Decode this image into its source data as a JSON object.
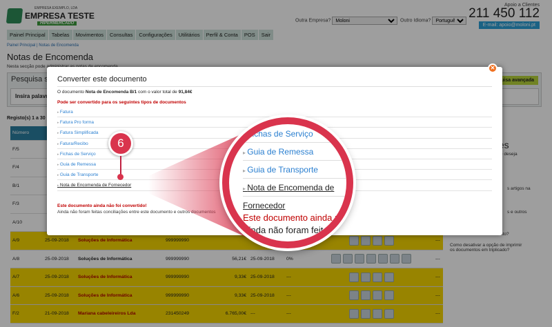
{
  "header": {
    "company_small": "EMPRESA EXEMPLO, LDA",
    "company": "EMPRESA TESTE",
    "tagline": "HIPERMERCADO",
    "other_company_label": "Outra Empresa?",
    "other_company_value": "Moloni",
    "language_label": "Outro Idioma?",
    "language_value": "Português",
    "support_label": "Apoio a Clientes",
    "phone": "211 450 112",
    "email": "E-mail: apoio@moloni.pt"
  },
  "nav": [
    "Painel Principal",
    "Tabelas",
    "Movimentos",
    "Consultas",
    "Configurações",
    "Utilitários",
    "Perfil & Conta",
    "POS",
    "Sair"
  ],
  "breadcrumb": [
    "Painel Principal",
    "Notas de Encomenda"
  ],
  "page": {
    "title": "Notas de Encomenda",
    "subtitle": "Nesta secção pode administrar as notas de encomenda",
    "search_title": "Pesquisa simples",
    "advanced": "Pesquisa avançada",
    "search_placeholder": "Insira palavras",
    "records": "Registo(s) 1 a 30"
  },
  "table": {
    "header": "Número",
    "rows": [
      {
        "num": "F/5",
        "y": false
      },
      {
        "num": "F/4",
        "y": false
      },
      {
        "num": "B/1",
        "y": false
      },
      {
        "num": "F/3",
        "y": false
      },
      {
        "num": "A/10",
        "y": false
      },
      {
        "num": "A/9",
        "date": "25-09-2018",
        "client": "Soluções de Informática",
        "nif": "999999990",
        "value": "",
        "due": "",
        "pct": "",
        "last": "---",
        "y": true
      },
      {
        "num": "A/8",
        "date": "25-09-2018",
        "client": "Soluções de Informática",
        "nif": "999999990",
        "value": "56,21€",
        "due": "25-09-2018",
        "pct": "0%",
        "last": "---",
        "y": false
      },
      {
        "num": "A/7",
        "date": "25-09-2018",
        "client": "Soluções de Informática",
        "nif": "999999990",
        "value": "9,33€",
        "due": "25-09-2018",
        "pct": "---",
        "last": "---",
        "y": true
      },
      {
        "num": "A/6",
        "date": "25-09-2018",
        "client": "Soluções de Informática",
        "nif": "999999990",
        "value": "9,33€",
        "due": "25-09-2018",
        "pct": "---",
        "last": "---",
        "y": true
      },
      {
        "num": "F/2",
        "date": "21-09-2018",
        "client": "Mariana cabeleireiros Lda",
        "nif": "231450249",
        "value": "6.765,00€",
        "due": "---",
        "pct": "---",
        "last": "---",
        "y": true
      }
    ]
  },
  "side": {
    "title": "ções",
    "t1": "e deseja",
    "t2": "s artigos na",
    "t3": "s e outros",
    "q1": "Como anular um documento?",
    "q2": "Como desativar a opção de imprimir os documentos em triplicado?"
  },
  "modal": {
    "title": "Converter este documento",
    "intro_pre": "O documento ",
    "doc": "Nota de Encomenda B/1",
    "intro_mid": " com o valor total de ",
    "total": "91,84€",
    "convert_label": "Pode ser convertido para os seguintes tipos de documentos",
    "options": [
      "Fatura",
      "Fatura Pro forma",
      "Fatura Simplificada",
      "Fatura/Recibo",
      "Fichas de Serviço",
      "Guia de Remessa",
      "Guia de Transporte",
      "Nota de Encomenda de Fornecedor"
    ],
    "warn_title": "Este documento ainda não foi convertido!",
    "warn_text": "Ainda não foram feitas conciliações entre este documento e outros documentos"
  },
  "callout": {
    "step": "6"
  }
}
